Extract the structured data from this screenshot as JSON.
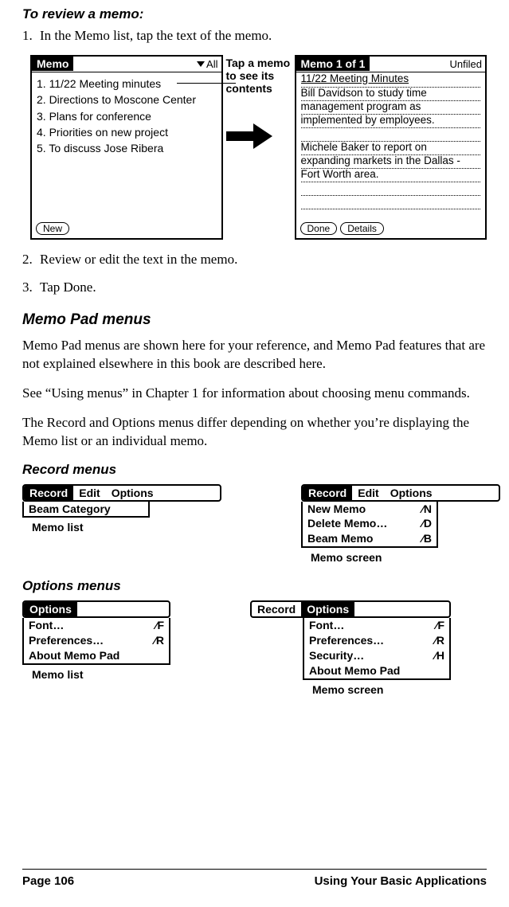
{
  "headings": {
    "to_review": "To review a memo:",
    "memopad_menus": "Memo Pad menus",
    "record_menus": "Record menus",
    "options_menus": "Options menus"
  },
  "steps": {
    "s1_num": "1.",
    "s1": "In the Memo list, tap the text of the memo.",
    "s2_num": "2.",
    "s2": "Review or edit the text in the memo.",
    "s3_num": "3.",
    "s3": "Tap Done."
  },
  "paras": {
    "p1": "Memo Pad menus are shown here for your reference, and Memo Pad features that are not explained elsewhere in this book are described here.",
    "p2": "See “Using menus” in Chapter 1 for information about choosing menu commands.",
    "p3": "The Record and Options menus differ depending on whether you’re displaying the Memo list or an individual memo."
  },
  "callout": {
    "text": "Tap a memo to see its contents"
  },
  "list_screen": {
    "title": "Memo",
    "category": "All",
    "items": [
      "1.  11/22 Meeting minutes",
      "2.  Directions to Moscone Center",
      "3.  Plans for conference",
      "4.  Priorities on new project",
      "5.  To discuss Jose Ribera"
    ],
    "new_btn": "New"
  },
  "detail_screen": {
    "title": "Memo 1 of 1",
    "category": "Unfiled",
    "heading": "11/22 Meeting Minutes",
    "lines": [
      "Bill Davidson to study time",
      "management program as",
      "implemented by employees.",
      "",
      "Michele Baker to report on",
      "expanding markets in the Dallas -",
      "Fort Worth area.",
      "",
      ""
    ],
    "done_btn": "Done",
    "details_btn": "Details"
  },
  "record_menu_list": {
    "tabs": [
      "Record",
      "Edit",
      "Options"
    ],
    "active": 0,
    "items": [
      {
        "label": "Beam Category",
        "sc": ""
      }
    ],
    "caption": "Memo list"
  },
  "record_menu_screen": {
    "tabs": [
      "Record",
      "Edit",
      "Options"
    ],
    "active": 0,
    "items": [
      {
        "label": "New Memo",
        "sc": "∕N"
      },
      {
        "label": "Delete Memo…",
        "sc": "∕D"
      },
      {
        "label": "Beam Memo",
        "sc": "∕B"
      }
    ],
    "caption": "Memo screen"
  },
  "options_menu_list": {
    "tabs": [
      "Options"
    ],
    "active": 0,
    "items": [
      {
        "label": "Font…",
        "sc": "∕F"
      },
      {
        "label": "Preferences…",
        "sc": "∕R"
      },
      {
        "label": "About Memo Pad",
        "sc": ""
      }
    ],
    "caption": "Memo list"
  },
  "options_menu_screen": {
    "tabs": [
      "Record",
      "Options"
    ],
    "active": 1,
    "items": [
      {
        "label": "Font…",
        "sc": "∕F"
      },
      {
        "label": "Preferences…",
        "sc": "∕R"
      },
      {
        "label": "Security…",
        "sc": "∕H"
      },
      {
        "label": "About Memo Pad",
        "sc": ""
      }
    ],
    "caption": "Memo screen"
  },
  "footer": {
    "left": "Page 106",
    "right": "Using Your Basic Applications"
  }
}
